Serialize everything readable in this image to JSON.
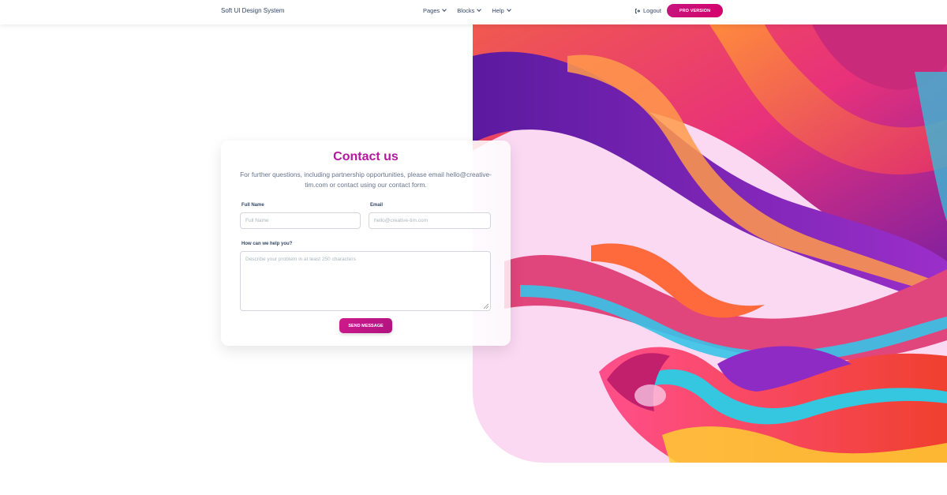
{
  "navbar": {
    "brand": "Soft UI Design System",
    "items": [
      {
        "label": "Pages"
      },
      {
        "label": "Blocks"
      },
      {
        "label": "Help"
      }
    ],
    "logout_label": "Logout",
    "pro_label": "PRO VERSION"
  },
  "contact": {
    "title": "Contact us",
    "subtitle": "For further questions, including partnership opportunities, please email hello@creative-tim.com or contact using our contact form.",
    "full_name_label": "Full Name",
    "full_name_placeholder": "Full Name",
    "email_label": "Email",
    "email_placeholder": "hello@creative-tim.com",
    "message_label": "How can we help you?",
    "message_placeholder": "Describe your problem in at least 250 characters",
    "send_label": "SEND MESSAGE"
  },
  "colors": {
    "accent": "#b5179e",
    "art_background": "#fbd9f2"
  },
  "icons": {
    "logout": "logout-icon",
    "nav_dropdown": "chevron-down-icon"
  }
}
